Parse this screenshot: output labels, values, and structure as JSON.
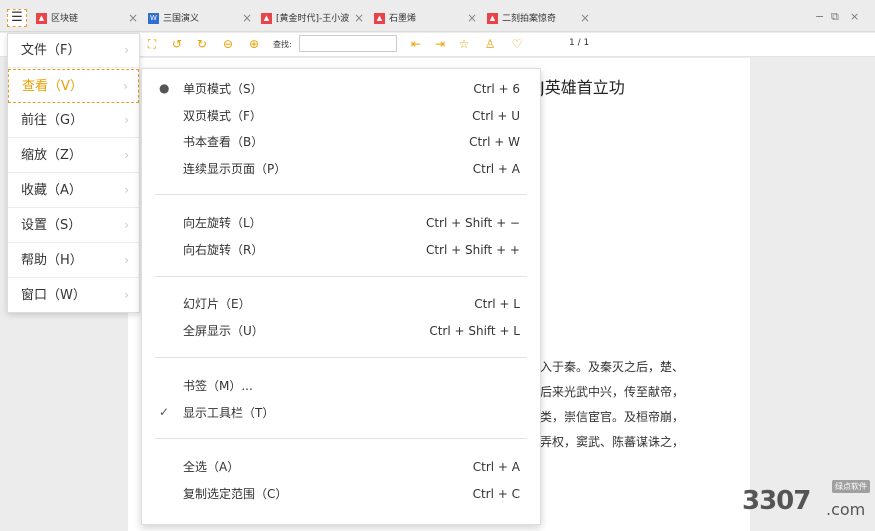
{
  "app": {
    "menu_icon": "hamburger-icon"
  },
  "tabs": [
    {
      "label": "区块链",
      "icon": "pdf-file-icon",
      "close": "×"
    },
    {
      "label": "三国演义",
      "icon": "word-file-icon",
      "close": "×"
    },
    {
      "label": "[黄金时代]-王小波",
      "icon": "pdf-file-icon",
      "close": "×"
    },
    {
      "label": "石墨烯",
      "icon": "pdf-file-icon",
      "close": "×"
    },
    {
      "label": "二刻拍案惊奇",
      "icon": "pdf-file-icon",
      "close": "×"
    }
  ],
  "window_controls": {
    "minimize": "−",
    "restore": "⧉",
    "close": "×"
  },
  "toolbar": {
    "find_label": "查找:",
    "find_value": "",
    "page_counter": "1 / 1"
  },
  "main_menu": {
    "items": [
      {
        "label": "文件（F）",
        "arrow": "›"
      },
      {
        "label": "查看（V）",
        "arrow": "›"
      },
      {
        "label": "前往（G）",
        "arrow": "›"
      },
      {
        "label": "缩放（Z）",
        "arrow": "›"
      },
      {
        "label": "收藏（A）",
        "arrow": "›"
      },
      {
        "label": "设置（S）",
        "arrow": "›"
      },
      {
        "label": "帮助（H）",
        "arrow": "›"
      },
      {
        "label": "窗口（W）",
        "arrow": "›"
      }
    ]
  },
  "view_menu": {
    "groups": [
      [
        {
          "mark": "●",
          "label": "单页模式（S）",
          "shortcut": "Ctrl + 6"
        },
        {
          "mark": "",
          "label": "双页模式（F）",
          "shortcut": "Ctrl + U"
        },
        {
          "mark": "",
          "label": "书本查看（B）",
          "shortcut": "Ctrl + W"
        },
        {
          "mark": "",
          "label": "连续显示页面（P）",
          "shortcut": "Ctrl + A"
        }
      ],
      [
        {
          "mark": "",
          "label": "向左旋转（L）",
          "shortcut": "Ctrl + Shift + −"
        },
        {
          "mark": "",
          "label": "向右旋转（R）",
          "shortcut": "Ctrl + Shift + +"
        }
      ],
      [
        {
          "mark": "",
          "label": "幻灯片（E）",
          "shortcut": "Ctrl + L"
        },
        {
          "mark": "",
          "label": "全屏显示（U）",
          "shortcut": "Ctrl + Shift + L"
        }
      ],
      [
        {
          "mark": "",
          "label": "书签（M）...",
          "shortcut": ""
        },
        {
          "mark": "✓",
          "label": "显示工具栏（T）",
          "shortcut": ""
        }
      ],
      [
        {
          "mark": "",
          "label": "全选（A）",
          "shortcut": "Ctrl + A"
        },
        {
          "mark": "",
          "label": "复制选定范围（C）",
          "shortcut": "Ctrl + C"
        }
      ]
    ]
  },
  "document": {
    "title_fragment": "J英雄首立功",
    "lines": [
      "入于秦。及秦灭之后，楚、",
      "后来光武中兴，传至献帝，",
      "类，崇信宦官。及桓帝崩，",
      "弄权，窦武、陈蕃谋诛之，"
    ]
  },
  "watermark": {
    "badge": "绿点软件",
    "number": "3307",
    "domain": ".com"
  }
}
